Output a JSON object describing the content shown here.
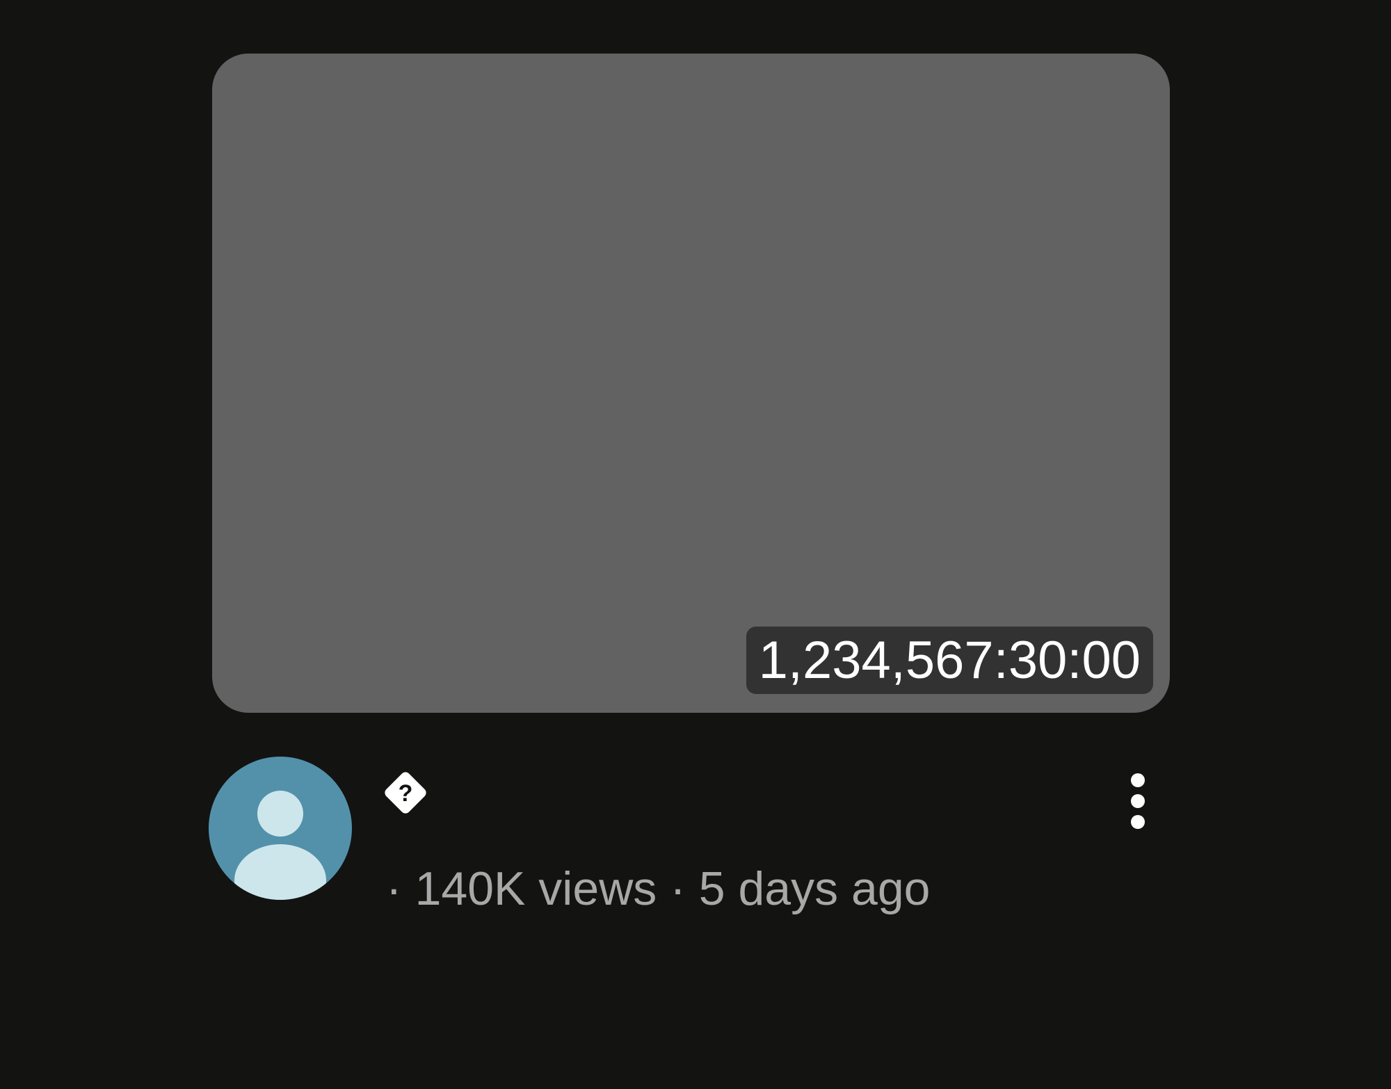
{
  "video": {
    "duration": "1,234,567:30:00",
    "views": "140K views",
    "age": "5 days ago",
    "separator": "·"
  },
  "icons": {
    "avatar": "default-user-avatar",
    "channel_badge": "question-diamond-icon",
    "more": "vertical-ellipsis-icon"
  },
  "colors": {
    "background": "#131312",
    "thumbnail": "#626262",
    "avatar_bg": "#5391aa",
    "avatar_figure": "#cde6ec",
    "meta_text": "#a8a8a8"
  }
}
